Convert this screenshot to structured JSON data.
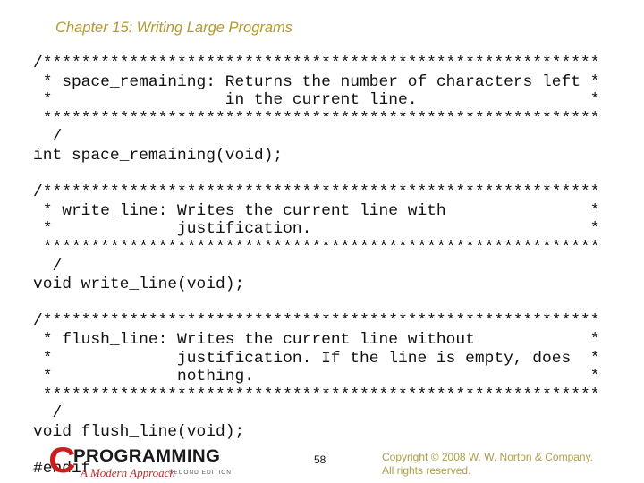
{
  "slide": {
    "title": "Chapter 15: Writing Large Programs",
    "code_lines": [
      "/**********************************************************",
      " * space_remaining: Returns the number of characters left *",
      " *                  in the current line.                  *",
      " **********************************************************",
      "  /",
      "int space_remaining(void);",
      "",
      "/**********************************************************",
      " * write_line: Writes the current line with               *",
      " *             justification.                             *",
      " **********************************************************",
      "  /",
      "void write_line(void);",
      "",
      "/**********************************************************",
      " * flush_line: Writes the current line without            *",
      " *             justification. If the line is empty, does  *",
      " *             nothing.                                   *",
      " **********************************************************",
      "  /",
      "void flush_line(void);",
      "",
      "#endif"
    ]
  },
  "footer": {
    "logo": {
      "letter": "C",
      "wordmark": "PROGRAMMING",
      "subtitle": "A Modern Approach",
      "edition": "SECOND EDITION"
    },
    "page_number": "58",
    "copyright_line1": "Copyright © 2008 W. W. Norton & Company.",
    "copyright_line2": "All rights reserved."
  },
  "colors": {
    "title": "#B39A2C",
    "copyright": "#ADA046",
    "logo_red": "#C8201E"
  }
}
